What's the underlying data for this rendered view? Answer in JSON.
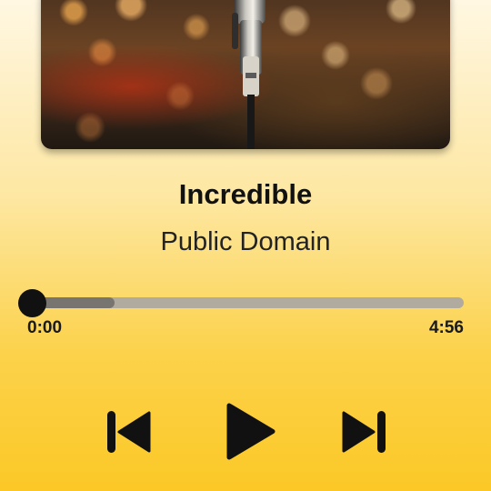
{
  "player": {
    "track_title": "Incredible",
    "artist": "Public Domain",
    "time_elapsed": "0:00",
    "time_total": "4:56",
    "progress": 0.0,
    "buffered": 0.2
  },
  "controls": {
    "previous_icon": "skip-previous-icon",
    "play_icon": "play-icon",
    "next_icon": "skip-next-icon"
  },
  "colors": {
    "background_top": "#fff7e2",
    "background_bottom": "#fbc826",
    "track": "#b0aa9f",
    "buffered": "#787570",
    "thumb": "#111111",
    "icons": "#111111"
  }
}
